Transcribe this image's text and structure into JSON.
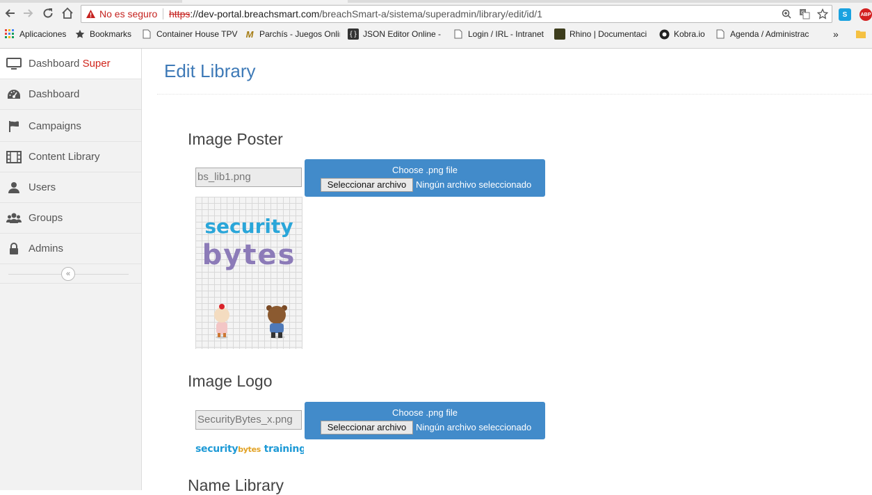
{
  "browser": {
    "security_warning": "No es seguro",
    "url_scheme": "https",
    "url_host": "://dev-portal.breachsmart.com",
    "url_path": "/breachSmart-a/sistema/superadmin/library/edit/id/1",
    "bookmarks": [
      {
        "label": "Aplicaciones",
        "icon": "apps-grid-icon"
      },
      {
        "label": "Bookmarks",
        "icon": "star-icon"
      },
      {
        "label": "Container House TPV",
        "icon": "page-icon"
      },
      {
        "label": "Parchís - Juegos Onlin",
        "icon": "parchis-icon"
      },
      {
        "label": "JSON Editor Online -",
        "icon": "json-icon"
      },
      {
        "label": "Login / IRL - Intranet",
        "icon": "page-icon"
      },
      {
        "label": "Rhino | Documentaci",
        "icon": "rhino-icon"
      },
      {
        "label": "Kobra.io",
        "icon": "kobra-icon"
      },
      {
        "label": "Agenda / Administrac",
        "icon": "page-icon"
      }
    ],
    "more": "»",
    "ext_abp": "ABP",
    "ext_skype": "S"
  },
  "sidebar": {
    "items": [
      {
        "label": "Dashboard ",
        "accent": "Super",
        "icon": "monitor-icon"
      },
      {
        "label": "Dashboard",
        "icon": "dashboard-gauge-icon"
      },
      {
        "label": "Campaigns",
        "icon": "flag-icon"
      },
      {
        "label": "Content Library",
        "icon": "film-icon"
      },
      {
        "label": "Users",
        "icon": "user-icon"
      },
      {
        "label": "Groups",
        "icon": "group-icon"
      },
      {
        "label": "Admins",
        "icon": "lock-icon"
      }
    ],
    "collapse_glyph": "«"
  },
  "main": {
    "title": "Edit Library",
    "poster": {
      "heading": "Image Poster",
      "filename": "bs_lib1.png",
      "choose_label": "Choose .png file",
      "button_label": "Seleccionar archivo",
      "no_file": "Ningún archivo seleccionado",
      "preview_line1": "security",
      "preview_line2": "bytes"
    },
    "logo": {
      "heading": "Image Logo",
      "filename": "SecurityBytes_x.png",
      "choose_label": "Choose .png file",
      "button_label": "Seleccionar archivo",
      "no_file": "Ningún archivo seleccionado",
      "preview_a": "security",
      "preview_b": "bytes",
      "preview_c": " training"
    },
    "name_heading": "Name Library"
  },
  "colors": {
    "accent_blue": "#428bca",
    "title_blue": "#3e7ab7",
    "accent_red": "#d0241b"
  }
}
